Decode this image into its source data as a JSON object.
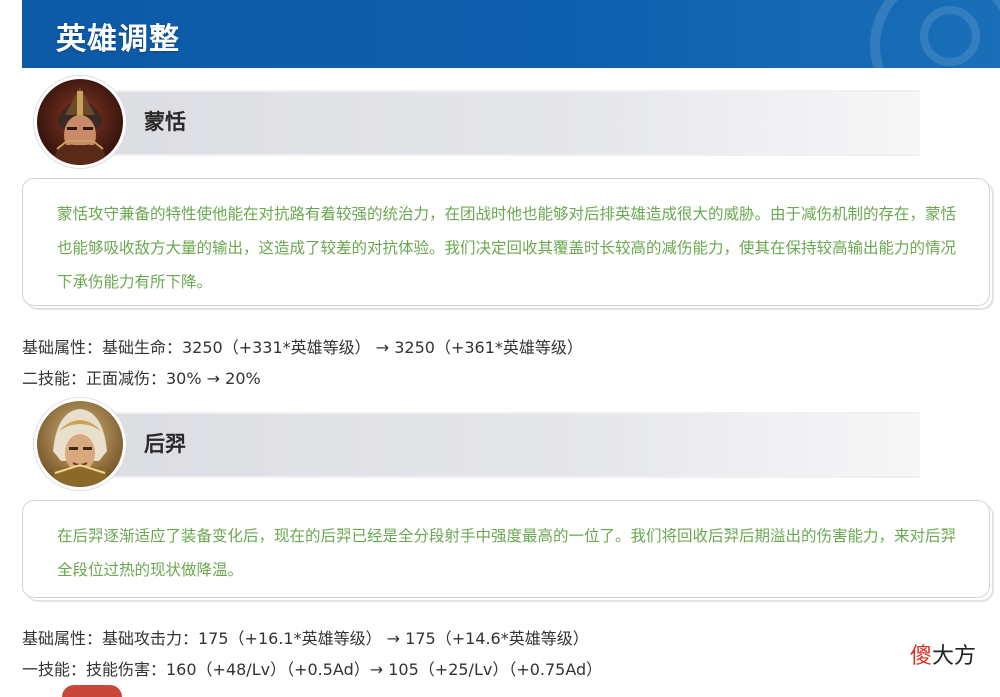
{
  "header": {
    "title": "英雄调整"
  },
  "heroes": [
    {
      "name": "蒙恬",
      "description": "蒙恬攻守兼备的特性使他能在对抗路有着较强的统治力，在团战时他也能够对后排英雄造成很大的威胁。由于减伤机制的存在，蒙恬也能够吸收敌方大量的输出，这造成了较差的对抗体验。我们决定回收其覆盖时长较高的减伤能力，使其在保持较高输出能力的情况下承伤能力有所下降。",
      "stats": [
        "基础属性：基础生命：3250（+331*英雄等级） → 3250（+361*英雄等级）",
        "二技能：正面减伤：30% → 20%"
      ]
    },
    {
      "name": "后羿",
      "description": "在后羿逐渐适应了装备变化后，现在的后羿已经是全分段射手中强度最高的一位了。我们将回收后羿后期溢出的伤害能力，来对后羿全段位过热的现状做降温。",
      "stats": [
        "基础属性：基础攻击力：175（+16.1*英雄等级） → 175（+14.6*英雄等级）",
        "一技能：技能伤害：160（+48/Lv）（+0.5Ad）→ 105（+25/Lv）（+0.75Ad）"
      ]
    }
  ],
  "watermark": {
    "part1": "傻",
    "part2": "大方"
  },
  "colors": {
    "banner": "#0e5fae",
    "desc_text": "#6aa84f",
    "accent_red": "#d93025"
  }
}
